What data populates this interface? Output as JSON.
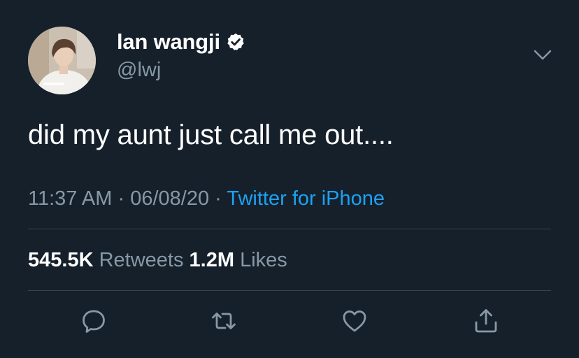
{
  "tweet": {
    "display_name": "lan wangji",
    "handle": "@lwj",
    "text": "did my aunt just call me out....",
    "time": "11:37 AM",
    "separator": "·",
    "date": "06/08/20",
    "source": "Twitter for iPhone",
    "retweets_count": "545.5K",
    "retweets_label": "Retweets",
    "likes_count": "1.2M",
    "likes_label": "Likes"
  },
  "colors": {
    "background": "#15202b",
    "primary_text": "#ffffff",
    "secondary_text": "#8899a6",
    "link": "#1da1f2",
    "divider": "#38444d"
  },
  "icons": {
    "verified": "verified-badge-icon",
    "caret": "chevron-down-icon",
    "reply": "reply-icon",
    "retweet": "retweet-icon",
    "like": "heart-icon",
    "share": "share-icon"
  }
}
